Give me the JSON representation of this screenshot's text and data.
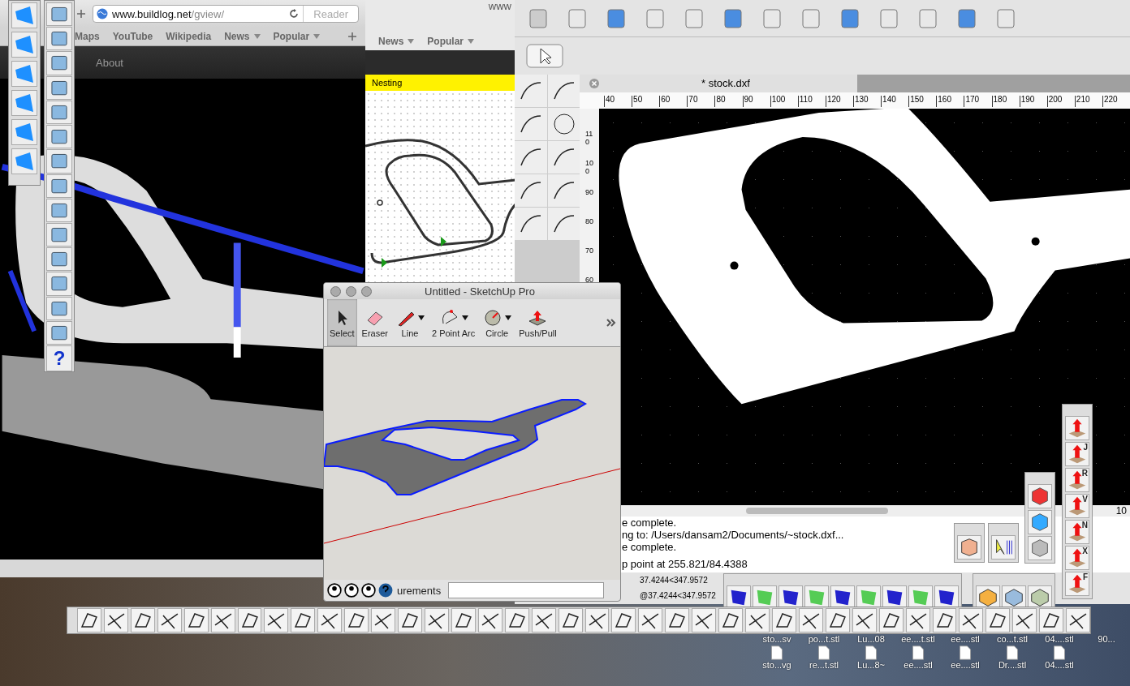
{
  "browser_front": {
    "url_host": "www.buildlog.net",
    "url_path": "/gview/",
    "reader": "Reader",
    "bookmarks": [
      {
        "label": "Maps",
        "menu": false
      },
      {
        "label": "YouTube",
        "menu": false
      },
      {
        "label": "Wikipedia",
        "menu": false
      },
      {
        "label": "News",
        "menu": true
      },
      {
        "label": "Popular",
        "menu": true
      }
    ],
    "nav": [
      "About"
    ]
  },
  "browser_back": {
    "title": "www",
    "bookmarks": [
      {
        "label": "News",
        "menu": true
      },
      {
        "label": "Popular",
        "menu": true
      }
    ],
    "banner": "Nesting"
  },
  "left_palette": {
    "help": "?"
  },
  "qcad": {
    "tab": "* stock.dxf",
    "x_ticks": [
      "40",
      "50",
      "60",
      "70",
      "80",
      "90",
      "100",
      "110",
      "120",
      "130",
      "140",
      "150",
      "160",
      "170",
      "180",
      "190",
      "200",
      "210",
      "220"
    ],
    "y_ticks": [
      "110",
      "100",
      "90",
      "80",
      "70",
      "60"
    ],
    "console": [
      "e complete.",
      "ng to: /Users/dansam2/Documents/~stock.dxf...",
      "e complete.",
      "p point at 255.821/84.4388"
    ],
    "status": [
      "37.4244<347.9572",
      "@37.4244<347.9572"
    ],
    "corner": "10"
  },
  "axis_toolbar": {
    "letters": [
      "J",
      "R",
      "V",
      "N",
      "X",
      "F"
    ]
  },
  "sketchup": {
    "title": "Untitled - SketchUp Pro",
    "tools": [
      {
        "label": "Select",
        "selected": true,
        "menu": false,
        "kind": "select"
      },
      {
        "label": "Eraser",
        "selected": false,
        "menu": false,
        "kind": "eraser"
      },
      {
        "label": "Line",
        "selected": false,
        "menu": true,
        "kind": "line"
      },
      {
        "label": "2 Point Arc",
        "selected": false,
        "menu": true,
        "kind": "arc"
      },
      {
        "label": "Circle",
        "selected": false,
        "menu": true,
        "kind": "circle"
      },
      {
        "label": "Push/Pull",
        "selected": false,
        "menu": false,
        "kind": "pushpull"
      }
    ],
    "status_label": "urements"
  },
  "desktop_icons": [
    [
      "sto...sv",
      "po...t.stl",
      "Lu...08",
      "ee....t.stl",
      "ee....stl",
      "co...t.stl",
      "04....stl",
      "90..."
    ],
    [
      "sto...vg",
      "re...t.stl",
      "Lu...8~",
      "ee....stl",
      "ee....stl",
      "Dr....stl",
      "04....stl"
    ]
  ]
}
